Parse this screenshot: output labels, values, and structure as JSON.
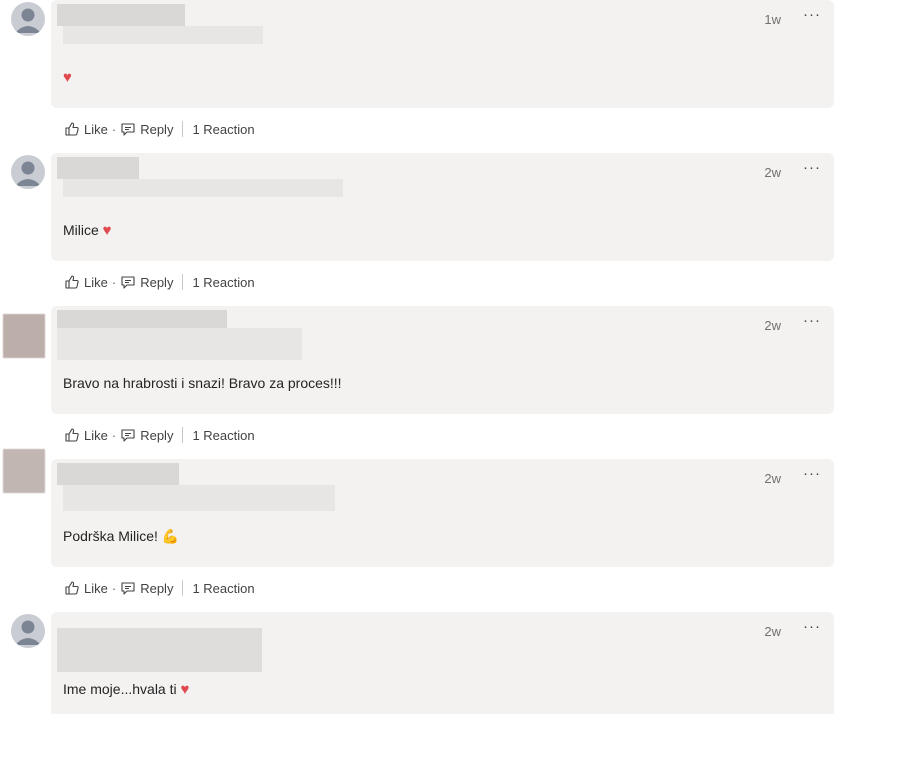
{
  "labels": {
    "like": "Like",
    "dot": "·",
    "reply": "Reply",
    "more": "···",
    "heart": "♥"
  },
  "comments": [
    {
      "time": "1w",
      "text": "",
      "emoji": "heart",
      "reactions": "1 Reaction"
    },
    {
      "time": "2w",
      "text": "Milice",
      "emoji": "heart",
      "reactions": "1 Reaction"
    },
    {
      "time": "2w",
      "text": "Bravo na hrabrosti i snazi! Bravo za proces!!!",
      "emoji": "",
      "reactions": "1 Reaction"
    },
    {
      "time": "2w",
      "text": "Podrška Milice!",
      "emoji": "muscle",
      "reactions": "1 Reaction"
    },
    {
      "time": "2w",
      "text": "Ime moje...hvala ti",
      "emoji": "heart",
      "reactions": ""
    }
  ],
  "colors": {
    "bubble": "#f3f2f1",
    "heart": "#e0494f",
    "muted": "#707070"
  },
  "icons": [
    "person-avatar-icon",
    "thumbs-up-icon",
    "reply-icon",
    "more-options-icon",
    "heart-icon",
    "muscle-emoji-icon"
  ]
}
